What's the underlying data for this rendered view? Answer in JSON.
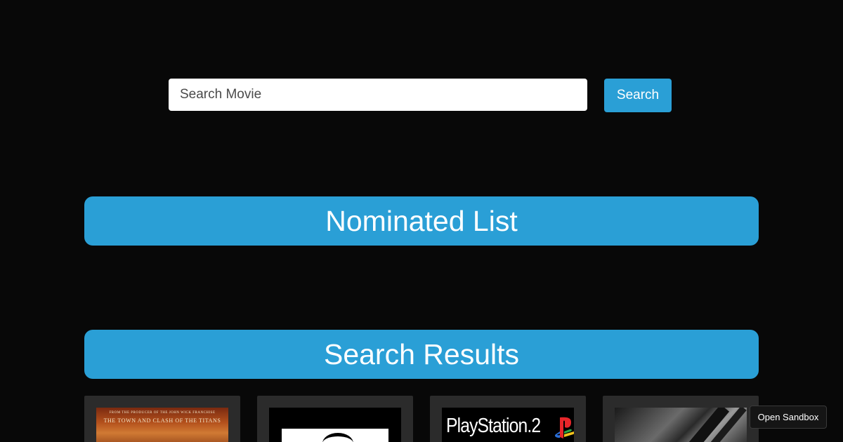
{
  "search": {
    "placeholder": "Search Movie",
    "value": "",
    "button_label": "Search"
  },
  "sections": {
    "nominated_title": "Nominated List",
    "results_title": "Search Results"
  },
  "results": [
    {
      "poster_text_line1": "FROM THE PRODUCER OF THE JOHN WICK FRANCHISE",
      "poster_text_line2": "THE TOWN AND CLASH OF THE TITANS"
    },
    {},
    {
      "poster_text": "PlayStation.2"
    },
    {}
  ],
  "sandbox": {
    "button_label": "Open Sandbox"
  },
  "colors": {
    "accent": "#2a9fd6",
    "background": "#080808",
    "card": "#2b2b2b"
  }
}
